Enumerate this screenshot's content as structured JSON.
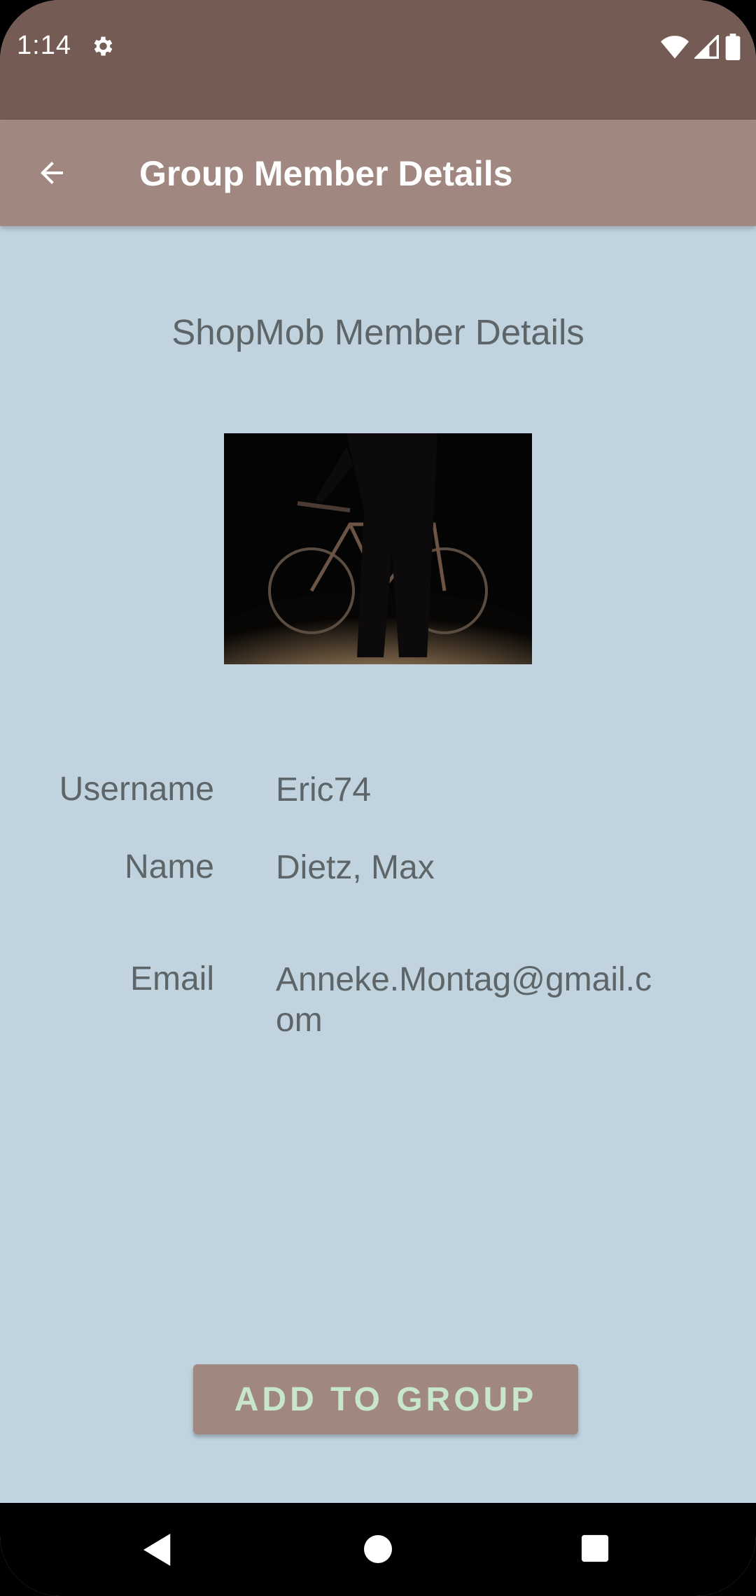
{
  "status_bar": {
    "time": "1:14",
    "icons": [
      "settings-icon",
      "wifi-icon",
      "cell-signal-icon",
      "battery-icon"
    ],
    "color": "#745b53"
  },
  "app_bar": {
    "title": "Group Member Details",
    "back_icon": "arrow-left-icon",
    "color": "#a08880"
  },
  "content": {
    "heading": "ShopMob Member Details",
    "photo": "member-photo",
    "fields": {
      "username_label": "Username",
      "username_value": "Eric74",
      "name_label": "Name",
      "name_value": "Dietz, Max",
      "email_label": "Email",
      "email_value": "Anneke.Montag@gmail.com"
    },
    "background": "#c0d3df"
  },
  "actions": {
    "add_label": "ADD TO GROUP",
    "add_text_color": "#c8e6c9"
  },
  "nav_bar": {
    "icons": [
      "back-triangle-icon",
      "home-circle-icon",
      "recents-square-icon"
    ]
  }
}
